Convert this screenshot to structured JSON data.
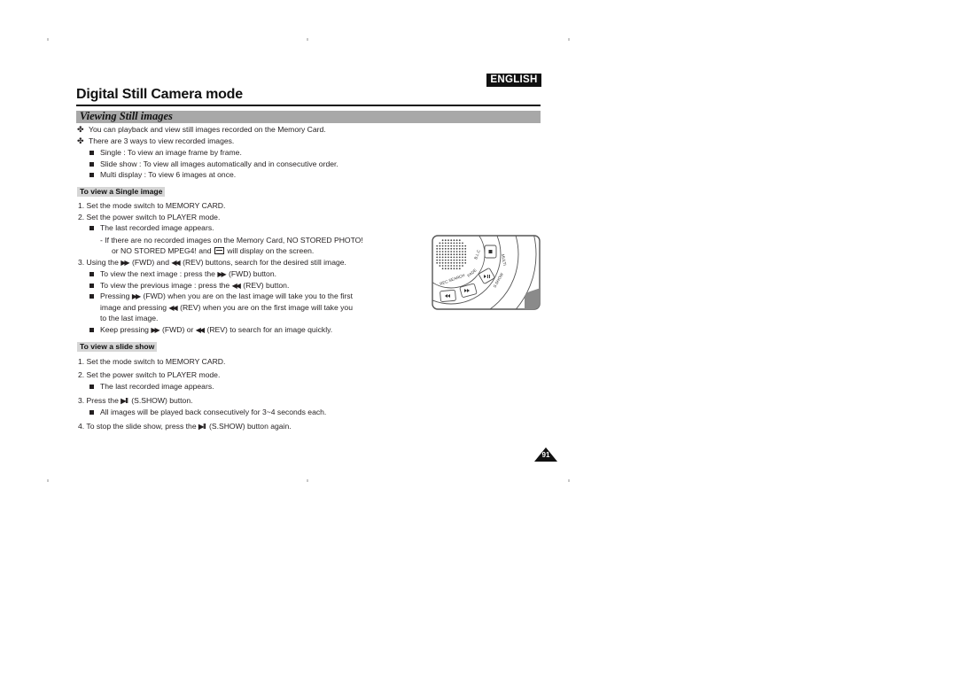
{
  "header": {
    "language_badge": "ENGLISH",
    "page_title": "Digital Still Camera mode",
    "section_title": "Viewing Still images"
  },
  "intro": {
    "bullets": [
      "You can playback and view still images recorded on the Memory Card.",
      "There are 3 ways to view recorded images."
    ],
    "sub_bullets": [
      "Single : To view an image frame by frame.",
      "Slide show : To view all images automatically and in consecutive order.",
      "Multi display : To view 6 images at once."
    ]
  },
  "single_image": {
    "heading": "To view a Single image",
    "step1": "1.  Set the mode switch to MEMORY CARD.",
    "step2": "2.  Set the power switch to PLAYER mode.",
    "step2_note": "The last recorded image appears.",
    "step2_dash_a": "-   If there are no recorded images on the Memory Card, NO STORED PHOTO!",
    "step2_dash_b_pre": "or NO STORED MPEG4! and",
    "step2_dash_b_post": "will display on the screen.",
    "step3_pre": "3.  Using the",
    "step3_mid": "(FWD) and",
    "step3_post": "(REV) buttons, search for the desired still image.",
    "note_next_pre": "To view the next image : press the",
    "note_next_post": "(FWD) button.",
    "note_prev_pre": "To view the previous image : press the",
    "note_prev_post": "(REV) button.",
    "note_wrap_a_pre": "Pressing",
    "note_wrap_a_post": "(FWD) when you are on the last image will take you to the first",
    "note_wrap_b_pre": "image and pressing",
    "note_wrap_b_post": "(REV) when you are on the first image will take you",
    "note_wrap_c": "to the last image.",
    "note_keep_pre": "Keep pressing",
    "note_keep_mid": "(FWD) or",
    "note_keep_post": "(REV) to search for an image quickly."
  },
  "slide_show": {
    "heading": "To view a slide show",
    "step1": "1.  Set the mode switch to MEMORY CARD.",
    "step2": "2.  Set the power switch to PLAYER mode.",
    "step2_note": "The last recorded image appears.",
    "step3_pre": "3.  Press the",
    "step3_post": "(S.SHOW) button.",
    "step3_note": "All images will be played back consecutively for 3~4 seconds each.",
    "step4_pre": "4.  To stop the slide show, press the",
    "step4_post": "(S.SHOW) button again."
  },
  "icons": {
    "fwd": "▶▶",
    "rev": "◀◀",
    "play_pause": "▶II",
    "cross_bullet": "✤"
  },
  "illustration": {
    "labels": [
      "B.L.C",
      "MULTI",
      "S.SHOW",
      "REC SEARCH",
      "FADE"
    ]
  },
  "footer": {
    "page_number": "91"
  }
}
